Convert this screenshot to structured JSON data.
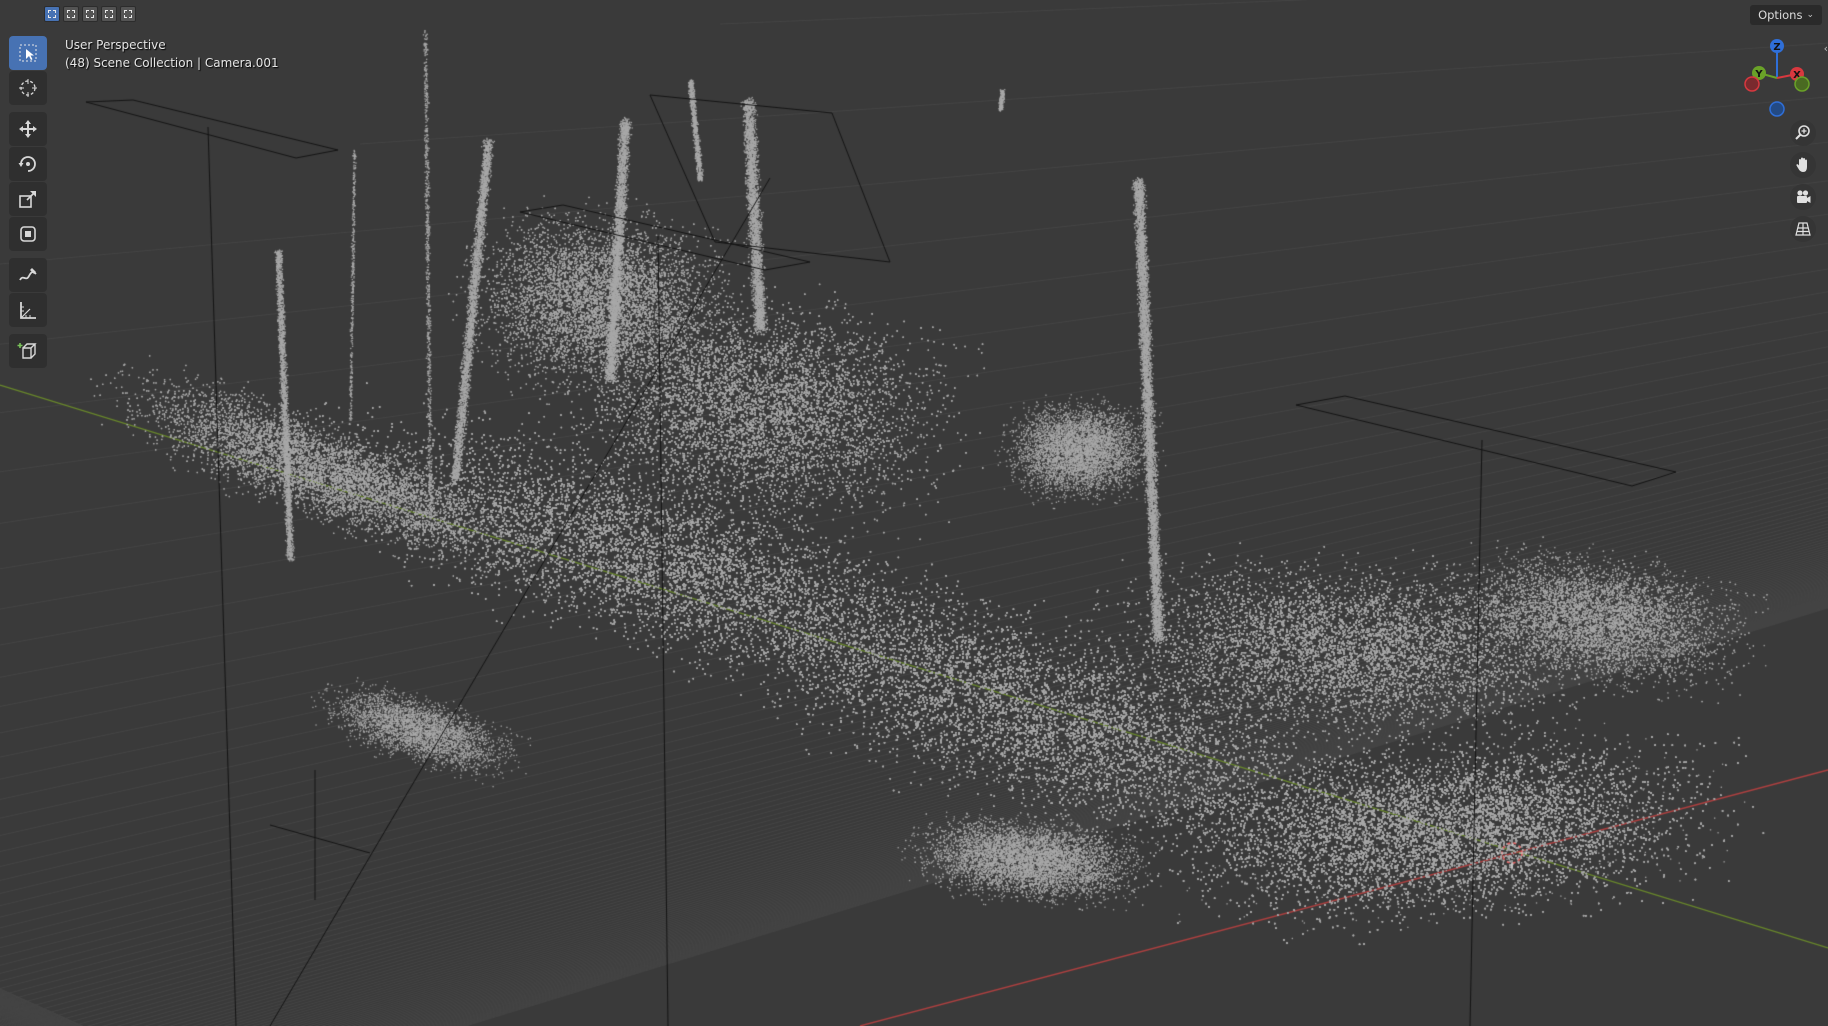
{
  "viewport": {
    "view_name": "User Perspective",
    "collection_info": "(48) Scene Collection | Camera.001",
    "options_label": "Options",
    "background_color": "#3a3a3a",
    "grid_color": "#454545",
    "x_axis_color": "#b04040",
    "y_axis_color": "#6a8a2a",
    "point_color": "#a8a8a8",
    "cursor_color": "#e06060"
  },
  "header": {
    "select_modes": [
      "select-new-icon",
      "select-extend-icon",
      "select-subtract-icon",
      "select-invert-icon",
      "select-intersect-icon"
    ],
    "active_mode": 0
  },
  "toolbar": {
    "tools": [
      {
        "name": "select-box-icon",
        "active": true
      },
      {
        "name": "cursor-icon",
        "active": false
      },
      {
        "name": "move-icon",
        "active": false
      },
      {
        "name": "rotate-icon",
        "active": false
      },
      {
        "name": "scale-icon",
        "active": false
      },
      {
        "name": "transform-icon",
        "active": false
      },
      {
        "name": "annotate-icon",
        "active": false
      },
      {
        "name": "measure-icon",
        "active": false
      },
      {
        "name": "add-cube-icon",
        "active": false
      }
    ]
  },
  "gizmo": {
    "axes": [
      {
        "label": "Z",
        "color": "#2f6fd8"
      },
      {
        "label": "Y",
        "color": "#6aa228"
      },
      {
        "label": "X",
        "color": "#d8383f"
      }
    ]
  },
  "navigation": {
    "buttons": [
      "zoom-icon",
      "pan-hand-icon",
      "camera-view-icon",
      "perspective-grid-icon"
    ]
  }
}
